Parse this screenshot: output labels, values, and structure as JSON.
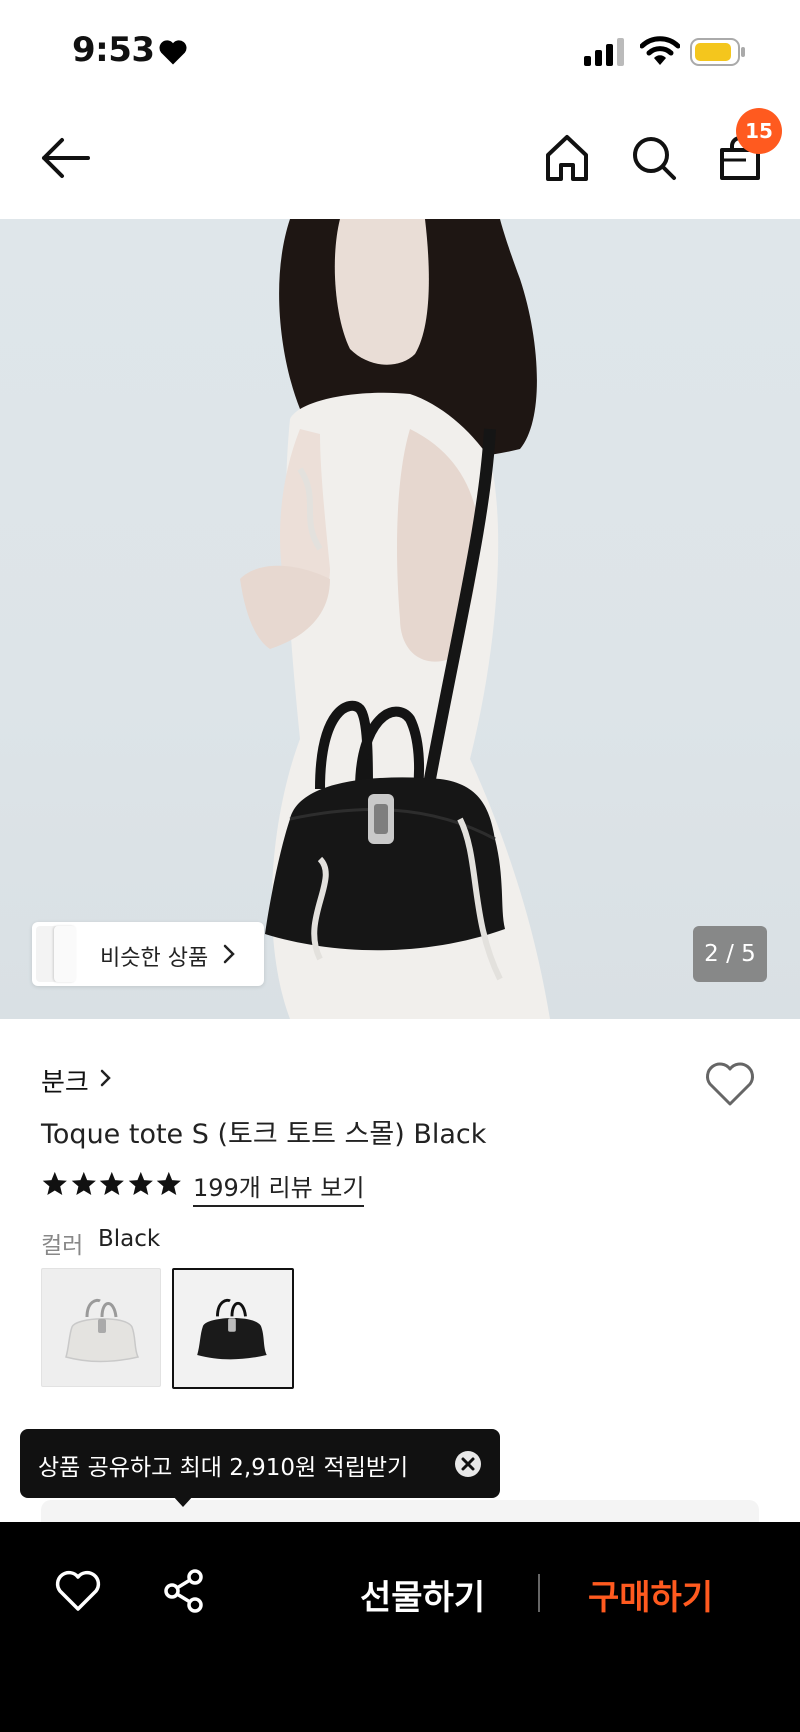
{
  "status_bar": {
    "time": "9:53"
  },
  "nav": {
    "cart_count": "15"
  },
  "gallery": {
    "similar_label": "비슷한 상품",
    "page_indicator": "2 / 5"
  },
  "product": {
    "brand": "분크",
    "title": "Toque tote S (토크 토트 스몰) Black",
    "rating_stars": 5,
    "review_link": "199개 리뷰 보기",
    "color_label": "컬러",
    "color_value": "Black",
    "color_options": [
      "gray",
      "Black"
    ]
  },
  "tooltip": {
    "text": "상품 공유하고 최대 2,910원 적립받기"
  },
  "bottom_bar": {
    "gift_label": "선물하기",
    "buy_label": "구매하기"
  },
  "colors": {
    "accent": "#ff5a1f",
    "bar": "#000000"
  }
}
